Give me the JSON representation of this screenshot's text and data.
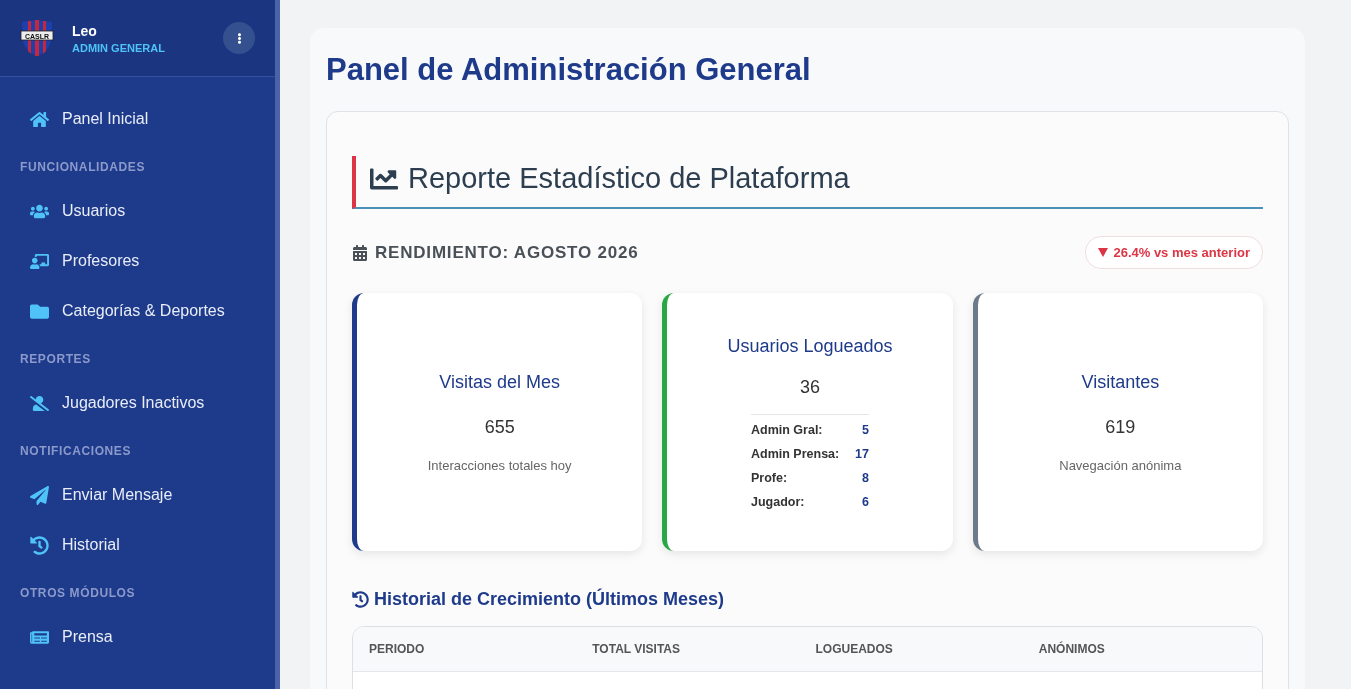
{
  "sidebar": {
    "logo": {
      "text": "CASLR"
    },
    "user": {
      "name": "Leo",
      "role": "ADMIN GENERAL"
    },
    "groups": [
      {
        "items": [
          {
            "label": "Panel Inicial"
          }
        ]
      },
      {
        "heading": "FUNCIONALIDADES",
        "items": [
          {
            "label": "Usuarios"
          },
          {
            "label": "Profesores"
          },
          {
            "label": "Categorías & Deportes"
          }
        ]
      },
      {
        "heading": "REPORTES",
        "items": [
          {
            "label": "Jugadores Inactivos"
          }
        ]
      },
      {
        "heading": "NOTIFICACIONES",
        "items": [
          {
            "label": "Enviar Mensaje"
          },
          {
            "label": "Historial"
          }
        ]
      },
      {
        "heading": "OTROS MÓDULOS",
        "items": [
          {
            "label": "Prensa"
          }
        ]
      }
    ]
  },
  "page": {
    "title": "Panel de Administración General",
    "report": {
      "title": "Reporte Estadístico de Plataforma",
      "period": "RENDIMIENTO: AGOSTO 2026",
      "trend": {
        "text": "26.4% vs mes anterior"
      },
      "cards": [
        {
          "kind": "simple",
          "color": "#1e3a8a",
          "title": "Visitas del Mes",
          "value": "655",
          "caption": "Interacciones totales hoy"
        },
        {
          "kind": "breakdown",
          "color": "#28a745",
          "title": "Usuarios Logueados",
          "value": "36",
          "rows": [
            {
              "label": "Admin Gral:",
              "value": "5"
            },
            {
              "label": "Admin Prensa:",
              "value": "17"
            },
            {
              "label": "Profe:",
              "value": "8"
            },
            {
              "label": "Jugador:",
              "value": "6"
            }
          ]
        },
        {
          "kind": "simple",
          "color": "#6c7a89",
          "title": "Visitantes",
          "value": "619",
          "caption": "Navegación anónima"
        }
      ],
      "history": {
        "title": "Historial de Crecimiento (Últimos Meses)",
        "columns": [
          "PERIODO",
          "TOTAL VISITAS",
          "LOGUEADOS",
          "ANÓNIMOS"
        ]
      }
    }
  }
}
